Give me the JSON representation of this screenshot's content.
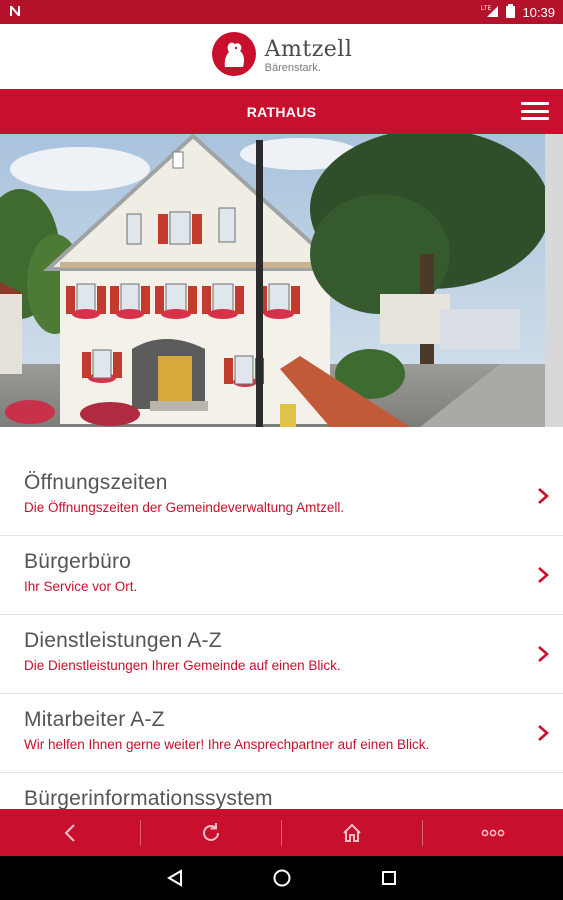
{
  "status_bar": {
    "notification_icon": "n-icon",
    "network_label": "LTE",
    "time": "10:39"
  },
  "header": {
    "logo_title": "Amtzell",
    "logo_subtitle": "Bärenstark."
  },
  "titlebar": {
    "title": "RATHAUS",
    "menu_icon": "hamburger-menu-icon"
  },
  "hero": {
    "image": "town-hall-photo"
  },
  "list": {
    "items": [
      {
        "title": "Öffnungszeiten",
        "subtitle": "Die Öffnungszeiten der Gemeindeverwaltung Amtzell."
      },
      {
        "title": "Bürgerbüro",
        "subtitle": "Ihr Service vor Ort."
      },
      {
        "title": "Dienstleistungen A-Z",
        "subtitle": "Die Dienstleistungen Ihrer Gemeinde auf einen Blick."
      },
      {
        "title": "Mitarbeiter A-Z",
        "subtitle": "Wir helfen Ihnen gerne weiter! Ihre Ansprechpartner auf einen Blick."
      },
      {
        "title": "Bürgerinformationssystem",
        "subtitle": ""
      }
    ]
  },
  "bottom_bar": {
    "items": [
      "back-icon",
      "reload-icon",
      "home-icon",
      "more-icon"
    ]
  },
  "colors": {
    "brand_red": "#c8102e",
    "status_red": "#b3122a",
    "text_gray": "#555555"
  }
}
